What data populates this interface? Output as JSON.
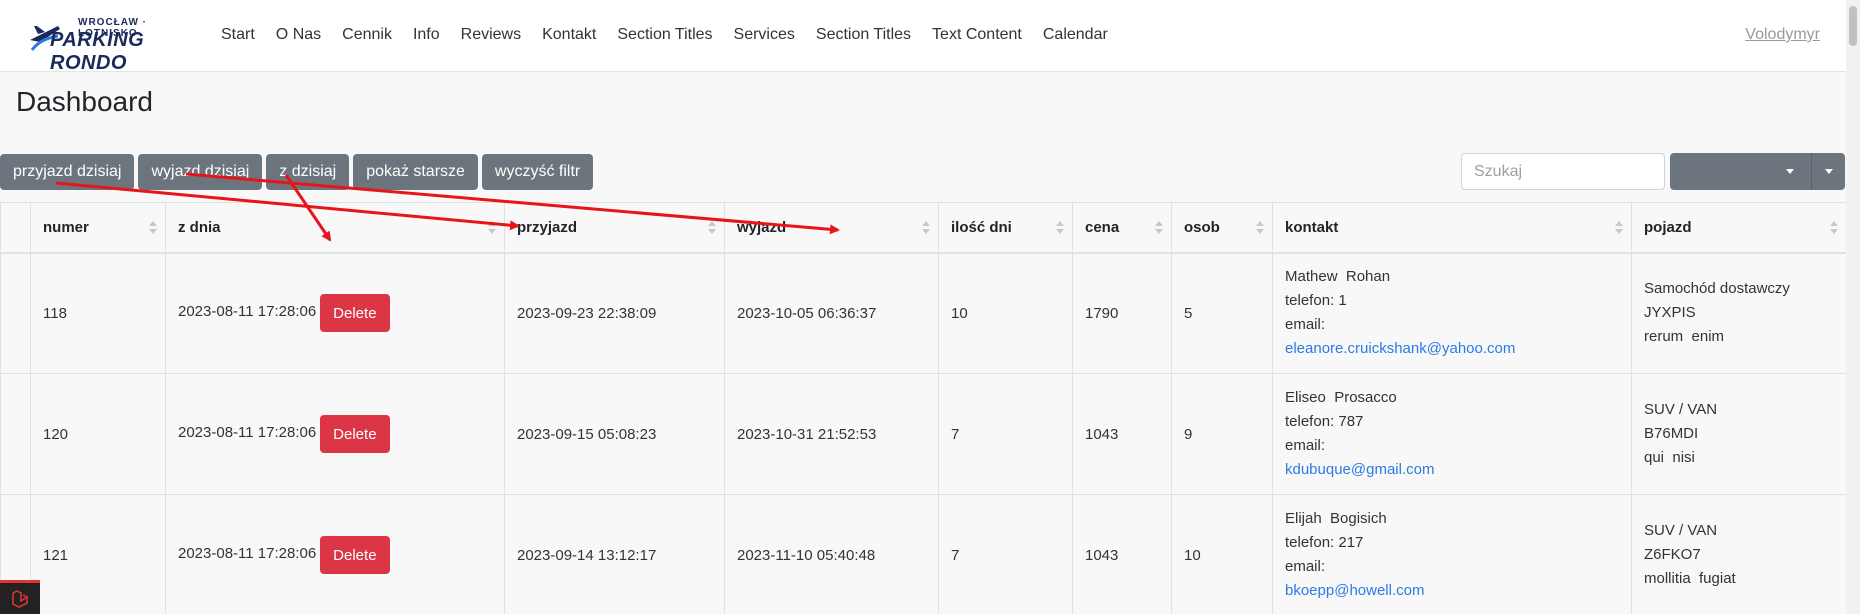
{
  "brand": {
    "top_text": "WROCŁAW · LOTNISKO",
    "name": "PARKING RONDO"
  },
  "nav": {
    "links": [
      "Start",
      "O Nas",
      "Cennik",
      "Info",
      "Reviews",
      "Kontakt",
      "Section Titles",
      "Services",
      "Section Titles",
      "Text Content",
      "Calendar"
    ],
    "user": "Volodymyr"
  },
  "page_title": "Dashboard",
  "filters": [
    "przyjazd dzisiaj",
    "wyjazd dzisiaj",
    "z dzisiaj",
    "pokaż starsze",
    "wyczyść filtr"
  ],
  "search": {
    "placeholder": "Szukaj"
  },
  "table": {
    "columns": [
      "",
      "numer",
      "z dnia",
      "przyjazd",
      "wyjazd",
      "ilość dni",
      "cena",
      "osob",
      "kontakt",
      "pojazd"
    ],
    "delete_label": "Delete",
    "rows": [
      {
        "numer": "118",
        "z_dnia": "2023-08-11 17:28:06",
        "przyjazd": "2023-09-23 22:38:09",
        "wyjazd": "2023-10-05 06:36:37",
        "dni": "10",
        "cena": "1790",
        "osob": "5",
        "kontakt_name": "Mathew  Rohan",
        "telefon": "telefon: 1",
        "email_label": "email:",
        "email": "eleanore.cruickshank@yahoo.com",
        "pojazd_type": "Samochód dostawczy",
        "pojazd_plate": "JYXPIS",
        "pojazd_note": "rerum  enim"
      },
      {
        "numer": "120",
        "z_dnia": "2023-08-11 17:28:06",
        "przyjazd": "2023-09-15 05:08:23",
        "wyjazd": "2023-10-31 21:52:53",
        "dni": "7",
        "cena": "1043",
        "osob": "9",
        "kontakt_name": "Eliseo  Prosacco",
        "telefon": "telefon: 787",
        "email_label": "email:",
        "email": "kdubuque@gmail.com",
        "pojazd_type": "SUV / VAN",
        "pojazd_plate": "B76MDI",
        "pojazd_note": "qui  nisi"
      },
      {
        "numer": "121",
        "z_dnia": "2023-08-11 17:28:06",
        "przyjazd": "2023-09-14 13:12:17",
        "wyjazd": "2023-11-10 05:40:48",
        "dni": "7",
        "cena": "1043",
        "osob": "10",
        "kontakt_name": "Elijah  Bogisich",
        "telefon": "telefon: 217",
        "email_label": "email:",
        "email": "bkoepp@howell.com",
        "pojazd_type": "SUV / VAN",
        "pojazd_plate": "Z6FKO7",
        "pojazd_note": "mollitia  fugiat"
      }
    ]
  },
  "colors": {
    "accent_button": "#6c757d",
    "danger": "#dc3545",
    "link": "#2c7be5",
    "annotation": "#e8141a"
  }
}
